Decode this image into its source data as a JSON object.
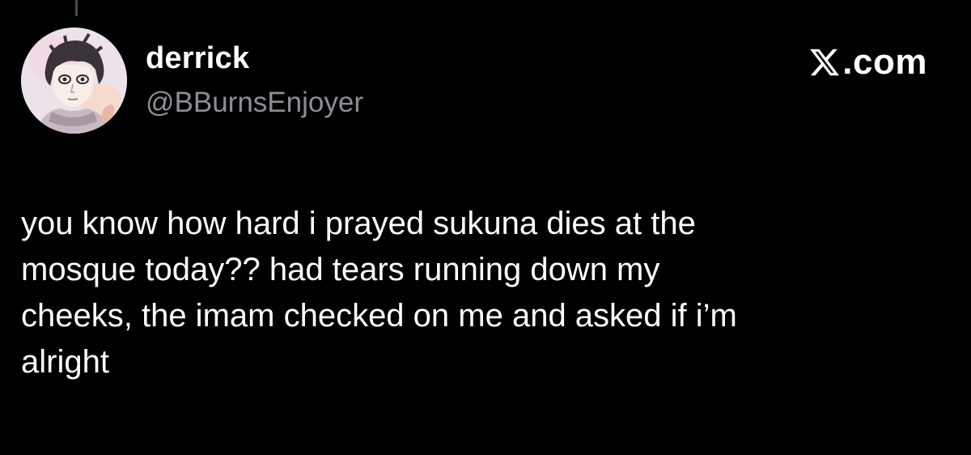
{
  "author": {
    "display_name": "derrick",
    "handle": "@BBurnsEnjoyer",
    "avatar_icon": "anime-character-avatar"
  },
  "brand": {
    "icon": "x-logo-icon",
    "text": ".com"
  },
  "tweet": {
    "text": "you know how hard i prayed sukuna dies at the\nmosque today??  had tears running down my\ncheeks, the imam checked on me and asked if i’m\nalright"
  },
  "colors": {
    "background": "#000000",
    "primary_text": "#ffffff",
    "secondary_text": "#8b9096",
    "thread_line": "#4a4a4a"
  }
}
